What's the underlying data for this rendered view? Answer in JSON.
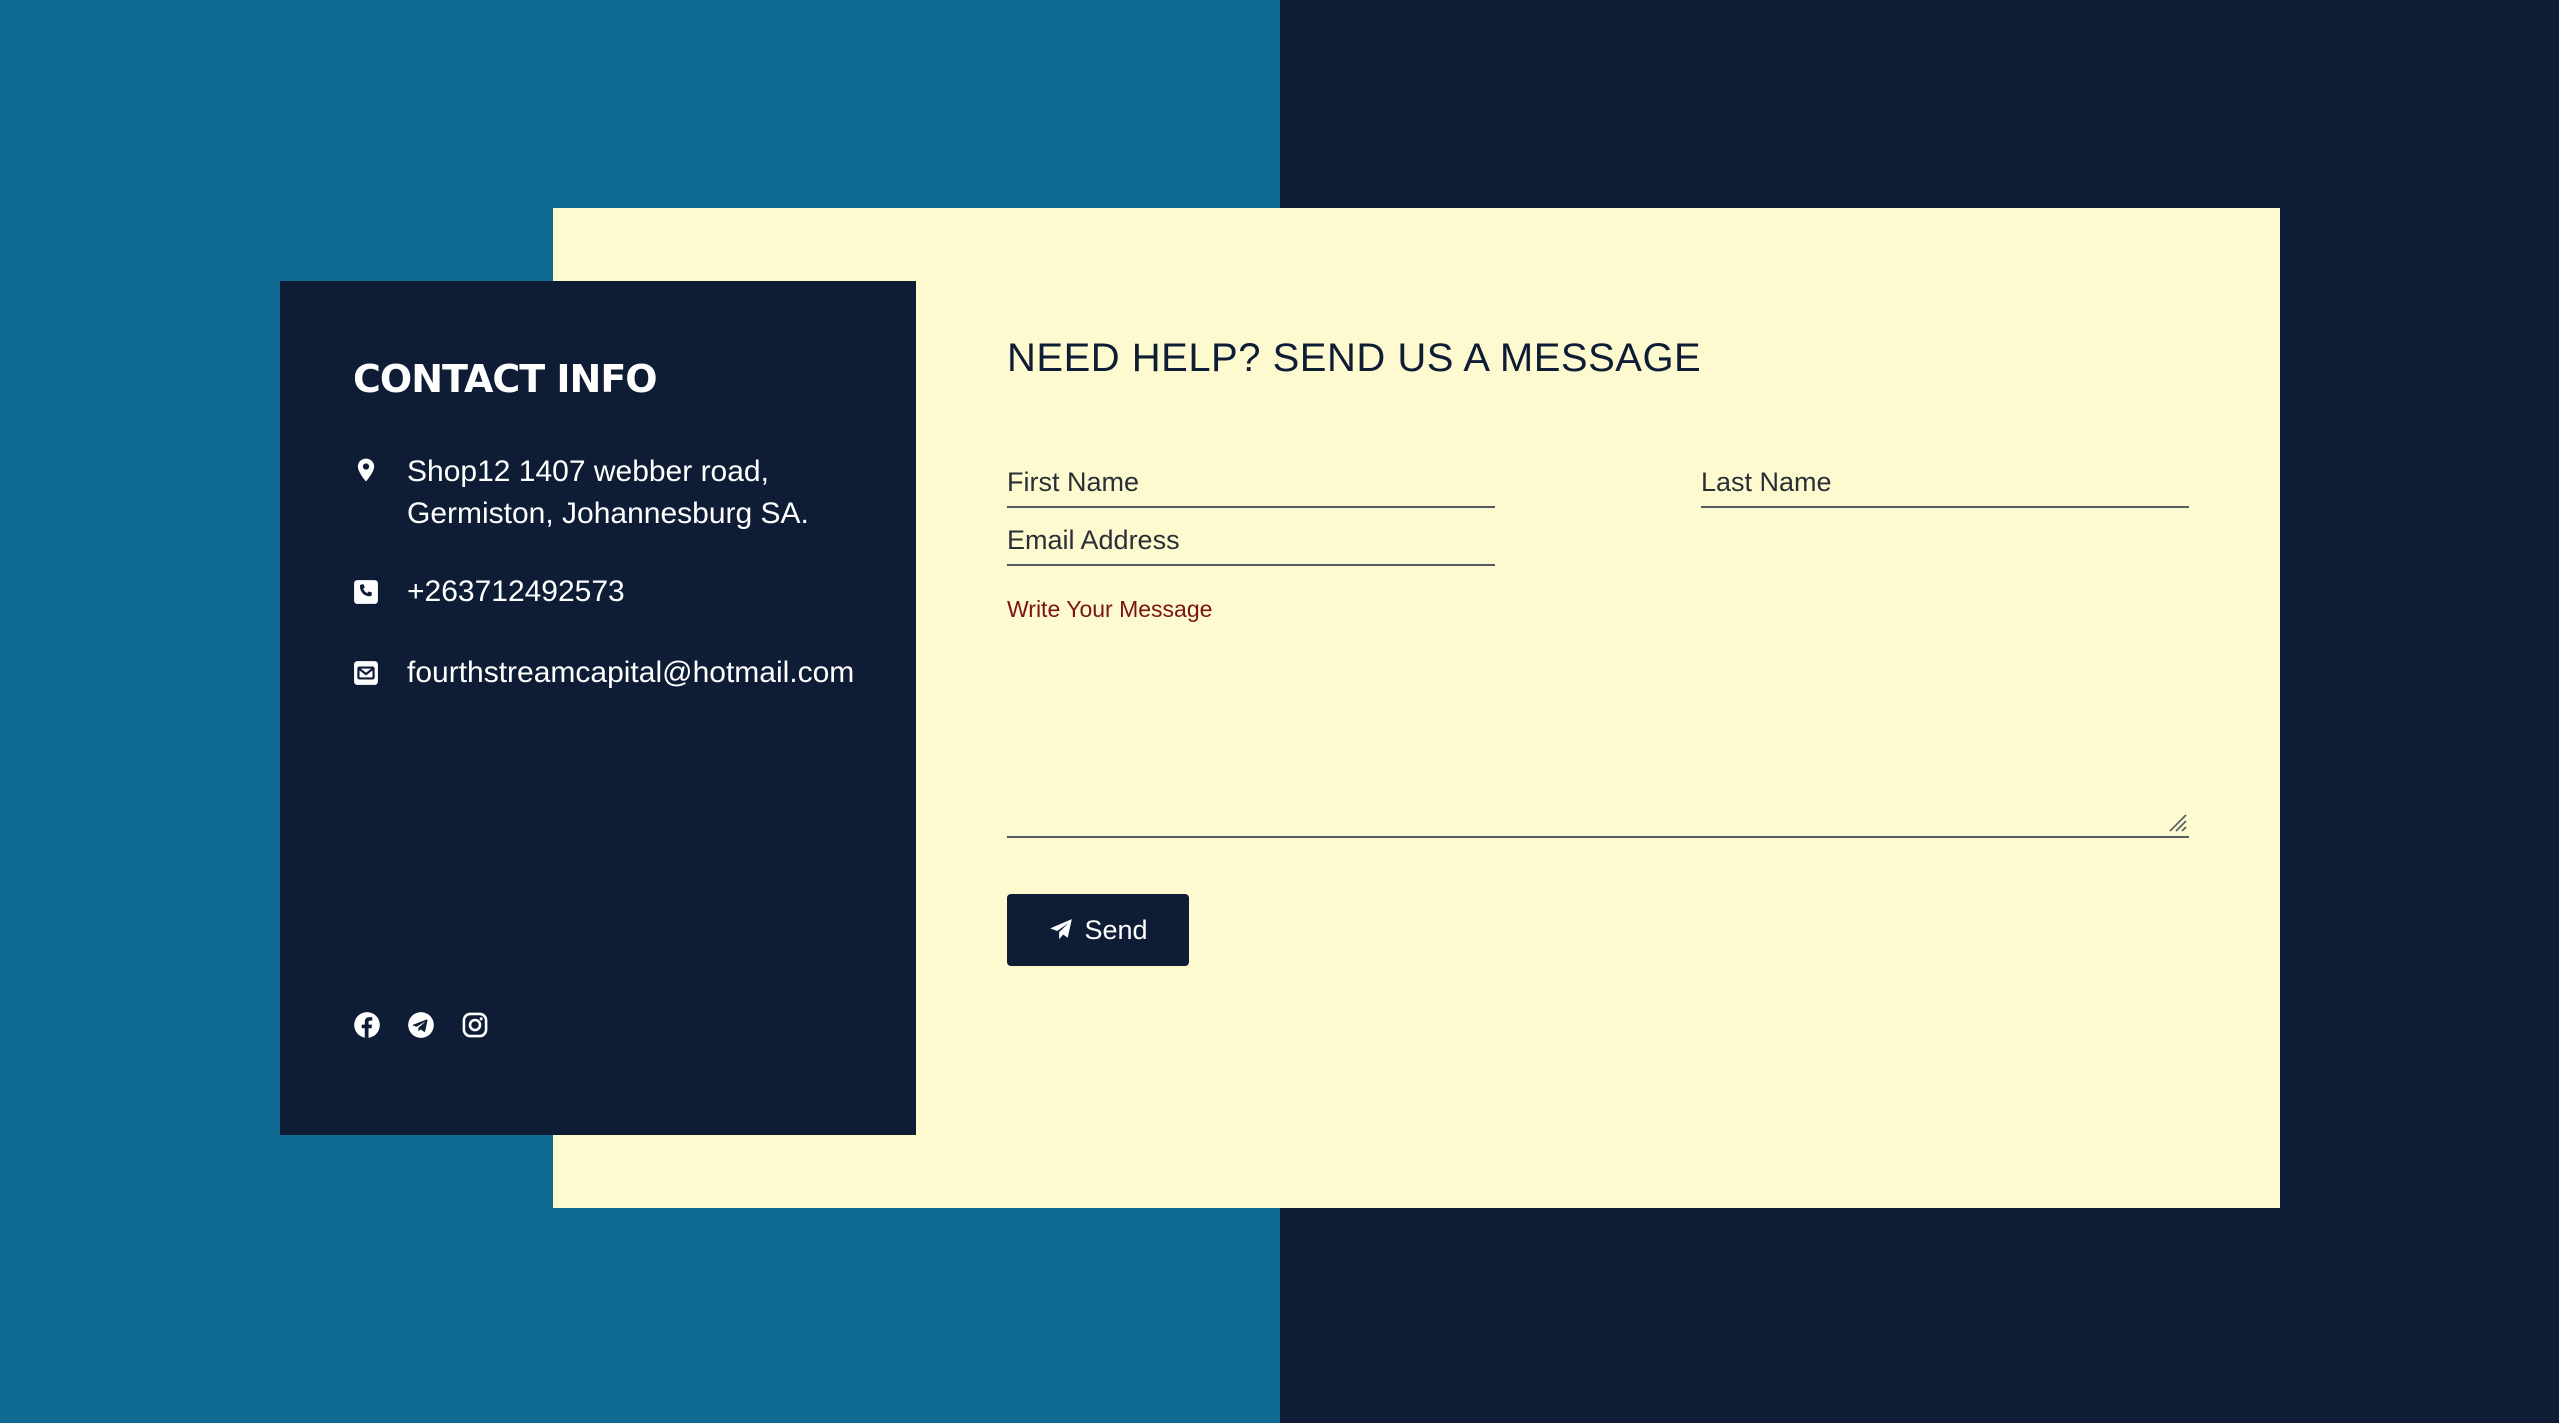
{
  "colors": {
    "left_background": "#0f6a93",
    "right_background": "#0e1d35",
    "form_card": "#fefad0",
    "info_card": "#0e1d35",
    "message_placeholder": "#7a1414"
  },
  "contact_info": {
    "title": "CONTACT INFO",
    "address_line1": "Shop12 1407 webber road,",
    "address_line2": "Germiston, Johannesburg SA.",
    "phone": "+263712492573",
    "email": "fourthstreamcapital@hotmail.com",
    "icons": {
      "address": "location-pin-icon",
      "phone": "phone-icon",
      "email": "envelope-icon"
    },
    "social": [
      "facebook-icon",
      "telegram-icon",
      "instagram-icon"
    ]
  },
  "form": {
    "title": "NEED HELP? SEND US A MESSAGE",
    "first_name_placeholder": "First Name",
    "last_name_placeholder": "Last Name",
    "email_placeholder": "Email Address",
    "message_placeholder": "Write Your Message",
    "send_label": "Send",
    "send_icon": "paper-plane-icon"
  }
}
